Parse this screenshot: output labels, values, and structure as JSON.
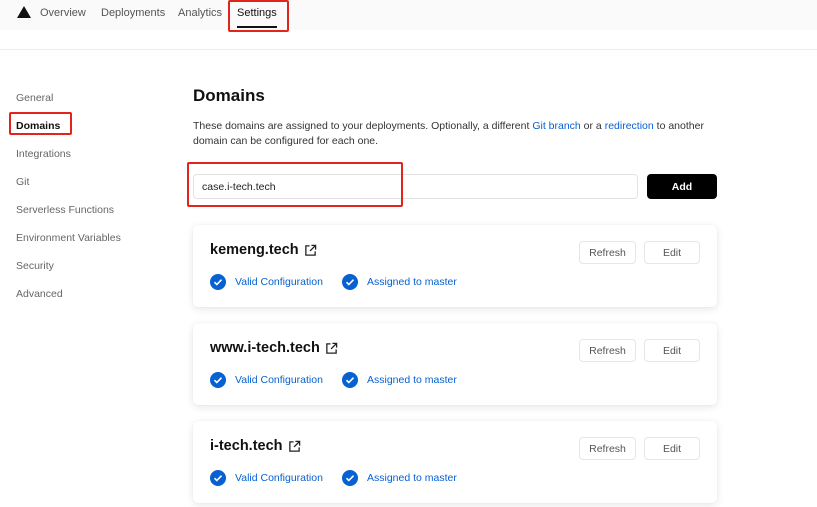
{
  "nav": {
    "tabs": [
      "Overview",
      "Deployments",
      "Analytics",
      "Settings"
    ],
    "active_tab": "Settings"
  },
  "sidebar": {
    "items": [
      "General",
      "Domains",
      "Integrations",
      "Git",
      "Serverless Functions",
      "Environment Variables",
      "Security",
      "Advanced"
    ],
    "active": "Domains"
  },
  "main": {
    "title": "Domains",
    "description": {
      "part1": "These domains are assigned to your deployments. Optionally, a different ",
      "link1": "Git branch",
      "part2": " or a ",
      "link2": "redirection",
      "part3": " to another domain can be configured for each one."
    },
    "input_value": "case.i-tech.tech",
    "add_label": "Add"
  },
  "domains": [
    {
      "name": "kemeng.tech",
      "status1": "Valid Configuration",
      "status2": "Assigned to master",
      "refresh": "Refresh",
      "edit": "Edit"
    },
    {
      "name": "www.i-tech.tech",
      "status1": "Valid Configuration",
      "status2": "Assigned to master",
      "refresh": "Refresh",
      "edit": "Edit"
    },
    {
      "name": "i-tech.tech",
      "status1": "Valid Configuration",
      "status2": "Assigned to master",
      "refresh": "Refresh",
      "edit": "Edit"
    }
  ],
  "colors": {
    "accent_blue": "#0761d1",
    "highlight_red": "#e1251b",
    "primary_button": "#000000"
  },
  "icons": {
    "logo": "triangle-logo-icon",
    "external": "external-link-icon",
    "check": "check-circle-icon"
  }
}
